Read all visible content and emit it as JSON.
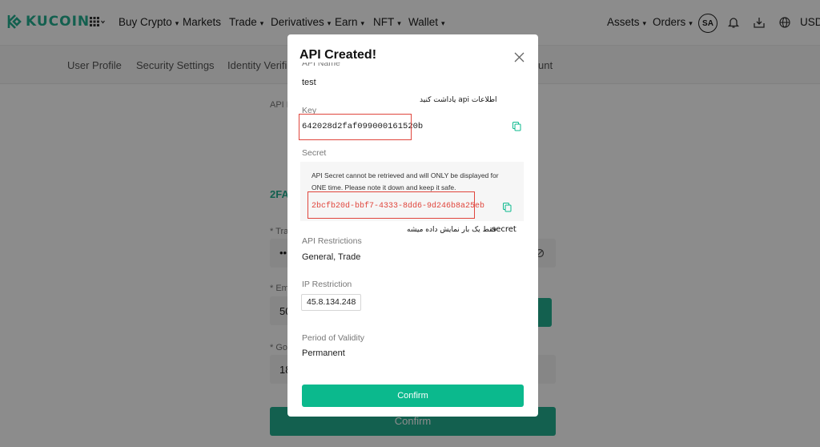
{
  "header": {
    "logo_text": "KUCOIN",
    "nav": [
      "Buy Crypto",
      "Markets",
      "Trade",
      "Derivatives",
      "Earn",
      "NFT",
      "Wallet"
    ],
    "right": {
      "assets": "Assets",
      "orders": "Orders",
      "avatar": "SA",
      "currency": "USD"
    }
  },
  "subnav": [
    "User Profile",
    "Security Settings",
    "Identity Verific",
    "unt"
  ],
  "background_form": {
    "api_label": "API N",
    "twofa_label": "2FA",
    "trading_label": "* Trad",
    "trading_value": "••",
    "email_label": "* Ema",
    "email_value": "50",
    "google_label": "* Goo",
    "google_value": "18",
    "confirm": "Confirm"
  },
  "modal": {
    "title": "API Created!",
    "api_name_label": "API Name",
    "api_name_value": "test",
    "key_label": "Key",
    "key_value": "642028d2faf099000161520b",
    "secret_label": "Secret",
    "secret_note": "API Secret cannot be retrieved and will ONLY be displayed for ONE time. Please note it down and keep it safe.",
    "secret_value": "2bcfb20d-bbf7-4333-8dd6-9d246b8a25eb",
    "restrictions_label": "API Restrictions",
    "restrictions_value": "General, Trade",
    "ip_label": "IP Restriction",
    "ip_value": "45.8.134.248",
    "validity_label": "Period of Validity",
    "validity_value": "Permanent",
    "confirm": "Confirm"
  },
  "annotations": {
    "note_api": "اطلاعات api یاداشت کنید",
    "note_secret_word": "secret",
    "note_secret": "فقط یک بار نمایش داده میشه"
  },
  "colors": {
    "brand": "#23af91",
    "confirm": "#0bb98d",
    "highlight": "#e0463d"
  }
}
